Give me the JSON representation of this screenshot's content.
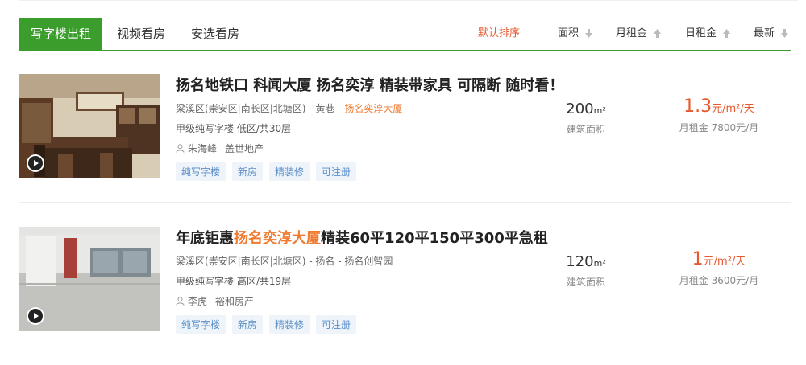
{
  "tabs": [
    {
      "label": "写字楼出租"
    },
    {
      "label": "视频看房"
    },
    {
      "label": "安选看房"
    }
  ],
  "sort_options": [
    {
      "label": "默认排序"
    },
    {
      "label": "面积"
    },
    {
      "label": "月租金"
    },
    {
      "label": "日租金"
    },
    {
      "label": "最新"
    }
  ],
  "listings": [
    {
      "title_pre": "扬名地铁口 科闻大厦 扬名奕淳 精装带家具 可隔断 随时看！",
      "title_hl": "",
      "title_post": "",
      "address_pre": "梁溪区(崇安区|南长区|北塘区) - 黄巷 - ",
      "address_hl": "扬名奕淳大厦",
      "meta": "甲级纯写字楼 低区/共30层",
      "agent_name": "朱海峰",
      "agent_company": "盖世地产",
      "tags": [
        "纯写字楼",
        "新房",
        "精装修",
        "可注册"
      ],
      "area_value": "200",
      "area_unit": "m²",
      "area_label": "建筑面积",
      "price_value": "1.3",
      "price_unit": "元/m²/天",
      "monthly_rent": "月租金 7800元/月"
    },
    {
      "title_pre": "年底钜惠",
      "title_hl": "扬名奕淳大厦",
      "title_post": "精装60平120平150平300平急租",
      "address_pre": "梁溪区(崇安区|南长区|北塘区) - 扬名 - 扬名创智园",
      "address_hl": "",
      "meta": "甲级纯写字楼 高区/共19层",
      "agent_name": "李虎",
      "agent_company": "裕和房产",
      "tags": [
        "纯写字楼",
        "新房",
        "精装修",
        "可注册"
      ],
      "area_value": "120",
      "area_unit": "m²",
      "area_label": "建筑面积",
      "price_value": "1",
      "price_unit": "元/m²/天",
      "monthly_rent": "月租金 3600元/月"
    }
  ]
}
